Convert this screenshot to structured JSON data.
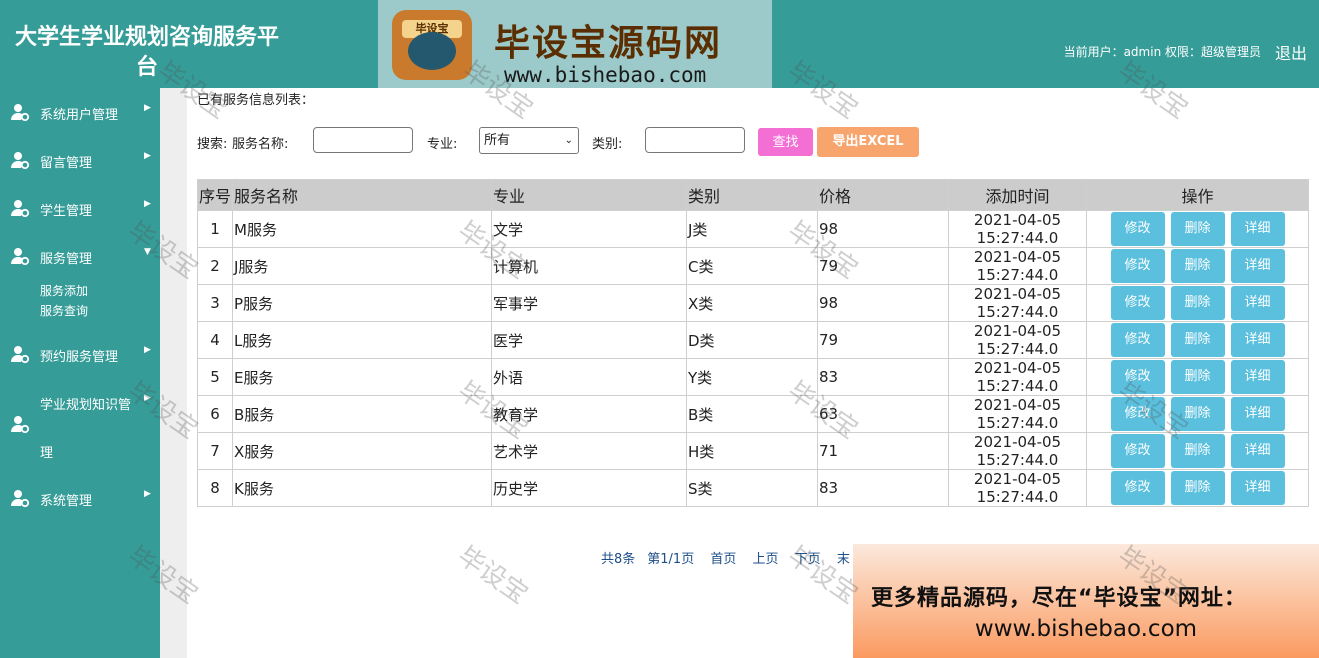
{
  "header": {
    "title": "大学生学业规划咨询服务平台",
    "user_info": "当前用户：admin  权限：超级管理员",
    "logout": "退出",
    "logo_badge": "毕设宝",
    "logo_text": "毕设宝源码网",
    "logo_url": "www.bishebao.com"
  },
  "sidebar": {
    "items": [
      {
        "label": "系统用户管理",
        "icon": "user-gear-icon"
      },
      {
        "label": "留言管理",
        "icon": "user-gear-icon"
      },
      {
        "label": "学生管理",
        "icon": "user-gear-icon"
      },
      {
        "label": "服务管理",
        "icon": "user-gear-icon",
        "expanded": true,
        "sub": [
          "服务添加",
          "服务查询"
        ]
      },
      {
        "label": "预约服务管理",
        "icon": "user-gear-icon"
      },
      {
        "label": "学业规划知识管",
        "label_cont": "理",
        "icon": "user-gear-icon"
      },
      {
        "label": "系统管理",
        "icon": "user-gear-icon"
      }
    ]
  },
  "main": {
    "section_title": "已有服务信息列表：",
    "search": {
      "label_search": "搜索:",
      "label_name": "服务名称:",
      "name_value": "",
      "label_major": "专业:",
      "major_value": "所有",
      "label_category": "类别:",
      "category_value": "",
      "find_button": "查找",
      "excel_button": "导出EXCEL"
    },
    "table": {
      "headers": [
        "序号",
        "服务名称",
        "专业",
        "类别",
        "价格",
        "添加时间",
        "操作"
      ],
      "rows": [
        {
          "idx": "1",
          "name": "M服务",
          "major": "文学",
          "cat": "J类",
          "price": "98",
          "date": "2021-04-05",
          "time": "15:27:44.0"
        },
        {
          "idx": "2",
          "name": "J服务",
          "major": "计算机",
          "cat": "C类",
          "price": "79",
          "date": "2021-04-05",
          "time": "15:27:44.0"
        },
        {
          "idx": "3",
          "name": "P服务",
          "major": "军事学",
          "cat": "X类",
          "price": "98",
          "date": "2021-04-05",
          "time": "15:27:44.0"
        },
        {
          "idx": "4",
          "name": "L服务",
          "major": "医学",
          "cat": "D类",
          "price": "79",
          "date": "2021-04-05",
          "time": "15:27:44.0"
        },
        {
          "idx": "5",
          "name": "E服务",
          "major": "外语",
          "cat": "Y类",
          "price": "83",
          "date": "2021-04-05",
          "time": "15:27:44.0"
        },
        {
          "idx": "6",
          "name": "B服务",
          "major": "教育学",
          "cat": "B类",
          "price": "63",
          "date": "2021-04-05",
          "time": "15:27:44.0"
        },
        {
          "idx": "7",
          "name": "X服务",
          "major": "艺术学",
          "cat": "H类",
          "price": "71",
          "date": "2021-04-05",
          "time": "15:27:44.0"
        },
        {
          "idx": "8",
          "name": "K服务",
          "major": "历史学",
          "cat": "S类",
          "price": "83",
          "date": "2021-04-05",
          "time": "15:27:44.0"
        }
      ],
      "op_labels": {
        "edit": "修改",
        "delete": "删除",
        "detail": "详细"
      }
    },
    "pager": {
      "total": "共8条",
      "page": "第1/1页",
      "first": "首页",
      "prev": "上页",
      "next": "下页",
      "last": "末"
    }
  },
  "ad": {
    "line1": "更多精品源码，尽在“毕设宝”网址：",
    "line2": "www.bishebao.com"
  },
  "watermark": "毕设宝",
  "colors": {
    "theme": "#369c98",
    "find": "#f36fd4",
    "excel": "#f7a56c",
    "op": "#5bc0de"
  }
}
